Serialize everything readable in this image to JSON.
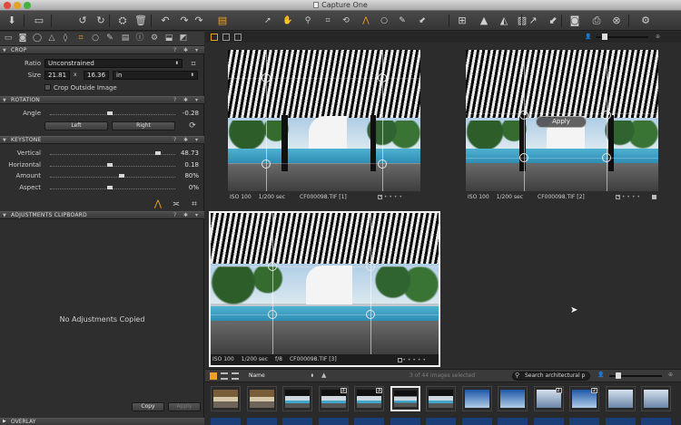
{
  "window": {
    "title": "Capture One"
  },
  "toolbar": {
    "icons": [
      "import-icon",
      "layout-icon",
      "rotate-left-icon",
      "rotate-right-icon",
      "process-icon",
      "delete-icon",
      "undo-icon",
      "redo-icon",
      "reset-icon",
      "stack-icon",
      "cursor-icon",
      "pan-icon",
      "zoom-icon",
      "crop-icon",
      "straighten-icon",
      "rotate-icon",
      "keystone-icon",
      "circle-icon",
      "picker-icon",
      "brush-icon",
      "grid-icon",
      "warning-icon",
      "flip-icon",
      "edit-icon",
      "camera-icon",
      "print-icon",
      "close-icon",
      "settings-icon"
    ]
  },
  "tool_tabs": {
    "icons": [
      "folder-icon",
      "camera-icon",
      "color-icon",
      "exposure-icon",
      "lens-icon",
      "crop-icon",
      "focus-icon",
      "picker-icon",
      "metadata-icon",
      "info-icon",
      "gear-icon",
      "output-icon",
      "batch-icon"
    ],
    "active": "crop-icon"
  },
  "crop": {
    "header": "CROP",
    "ratio_label": "Ratio",
    "ratio_value": "Unconstrained",
    "size_label": "Size",
    "width": "21.81",
    "times": "x",
    "height": "16.36",
    "unit": "in",
    "crop_outside_label": "Crop Outside Image"
  },
  "rotation": {
    "header": "ROTATION",
    "angle_label": "Angle",
    "angle_value": "-0.28",
    "left_label": "Left",
    "right_label": "Right"
  },
  "keystone": {
    "header": "KEYSTONE",
    "rows": [
      {
        "label": "Vertical",
        "value": "48.73",
        "level": 0.9
      },
      {
        "label": "Horizontal",
        "value": "0.18",
        "level": 0.5
      },
      {
        "label": "Amount",
        "value": "80%",
        "level": 0.6
      },
      {
        "label": "Aspect",
        "value": "0%",
        "level": 0.5
      }
    ]
  },
  "clipboard": {
    "header": "ADJUSTMENTS CLIPBOARD",
    "empty_message": "No Adjustments Copied",
    "copy_label": "Copy",
    "apply_label": "Apply"
  },
  "overlay": {
    "header": "OVERLAY"
  },
  "viewer": {
    "apply_button": "Apply",
    "photos": [
      {
        "iso": "ISO 100",
        "shutter": "1/200 sec",
        "aperture": "",
        "file": "CF000098.TIF [1]"
      },
      {
        "iso": "ISO 100",
        "shutter": "1/200 sec",
        "aperture": "",
        "file": "CF000098.TIF [2]"
      },
      {
        "iso": "ISO 100",
        "shutter": "1/200 sec",
        "aperture": "f/8",
        "file": "CF000098.TIF [3]"
      }
    ]
  },
  "browser": {
    "sort_label": "Name",
    "count": "3 of 44 images selected",
    "search_placeholder": "Search architectural p"
  },
  "filmstrip": {
    "thumbs": [
      {
        "kind": "pool-b",
        "badge": ""
      },
      {
        "kind": "pool-b",
        "badge": ""
      },
      {
        "kind": "pool-a",
        "badge": ""
      },
      {
        "kind": "pool-a",
        "badge": "3"
      },
      {
        "kind": "pool-a",
        "badge": "3"
      },
      {
        "kind": "pool-a",
        "badge": ""
      },
      {
        "kind": "pool-a",
        "badge": ""
      },
      {
        "kind": "tower",
        "badge": ""
      },
      {
        "kind": "tower",
        "badge": ""
      },
      {
        "kind": "tower-b",
        "badge": "2"
      },
      {
        "kind": "tower",
        "badge": "2"
      },
      {
        "kind": "tower-b",
        "badge": ""
      },
      {
        "kind": "tower-b",
        "badge": ""
      }
    ]
  }
}
